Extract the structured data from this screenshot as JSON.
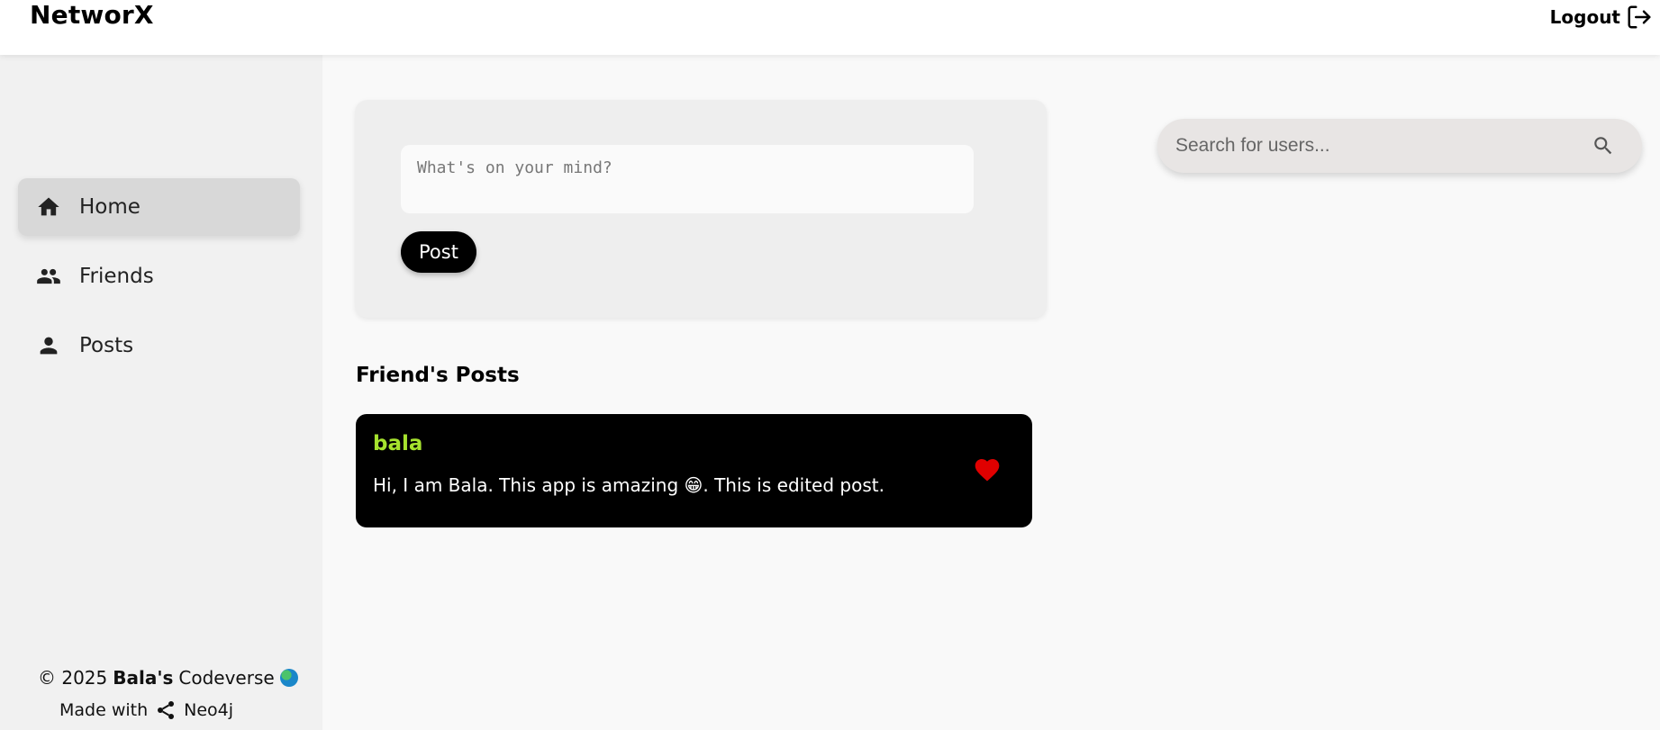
{
  "header": {
    "brand": "NetworX",
    "logout_label": "Logout"
  },
  "sidebar": {
    "items": [
      {
        "label": "Home",
        "icon": "home-icon",
        "active": true
      },
      {
        "label": "Friends",
        "icon": "people-icon",
        "active": false
      },
      {
        "label": "Posts",
        "icon": "person-icon",
        "active": false
      }
    ],
    "footer": {
      "copyright": "© 2025",
      "owner": "Bala's",
      "site": "Codeverse",
      "made_with": "Made with",
      "tech": "Neo4j"
    }
  },
  "composer": {
    "placeholder": "What's on your mind?",
    "post_label": "Post"
  },
  "feed": {
    "title": "Friend's Posts",
    "posts": [
      {
        "author": "bala",
        "text": "Hi, I am Bala. This app is amazing 😁. This is edited post.",
        "liked": true
      }
    ]
  },
  "search": {
    "placeholder": "Search for users..."
  },
  "colors": {
    "author": "#a6e22e",
    "like": "#e00000",
    "post_bg": "#000000"
  }
}
